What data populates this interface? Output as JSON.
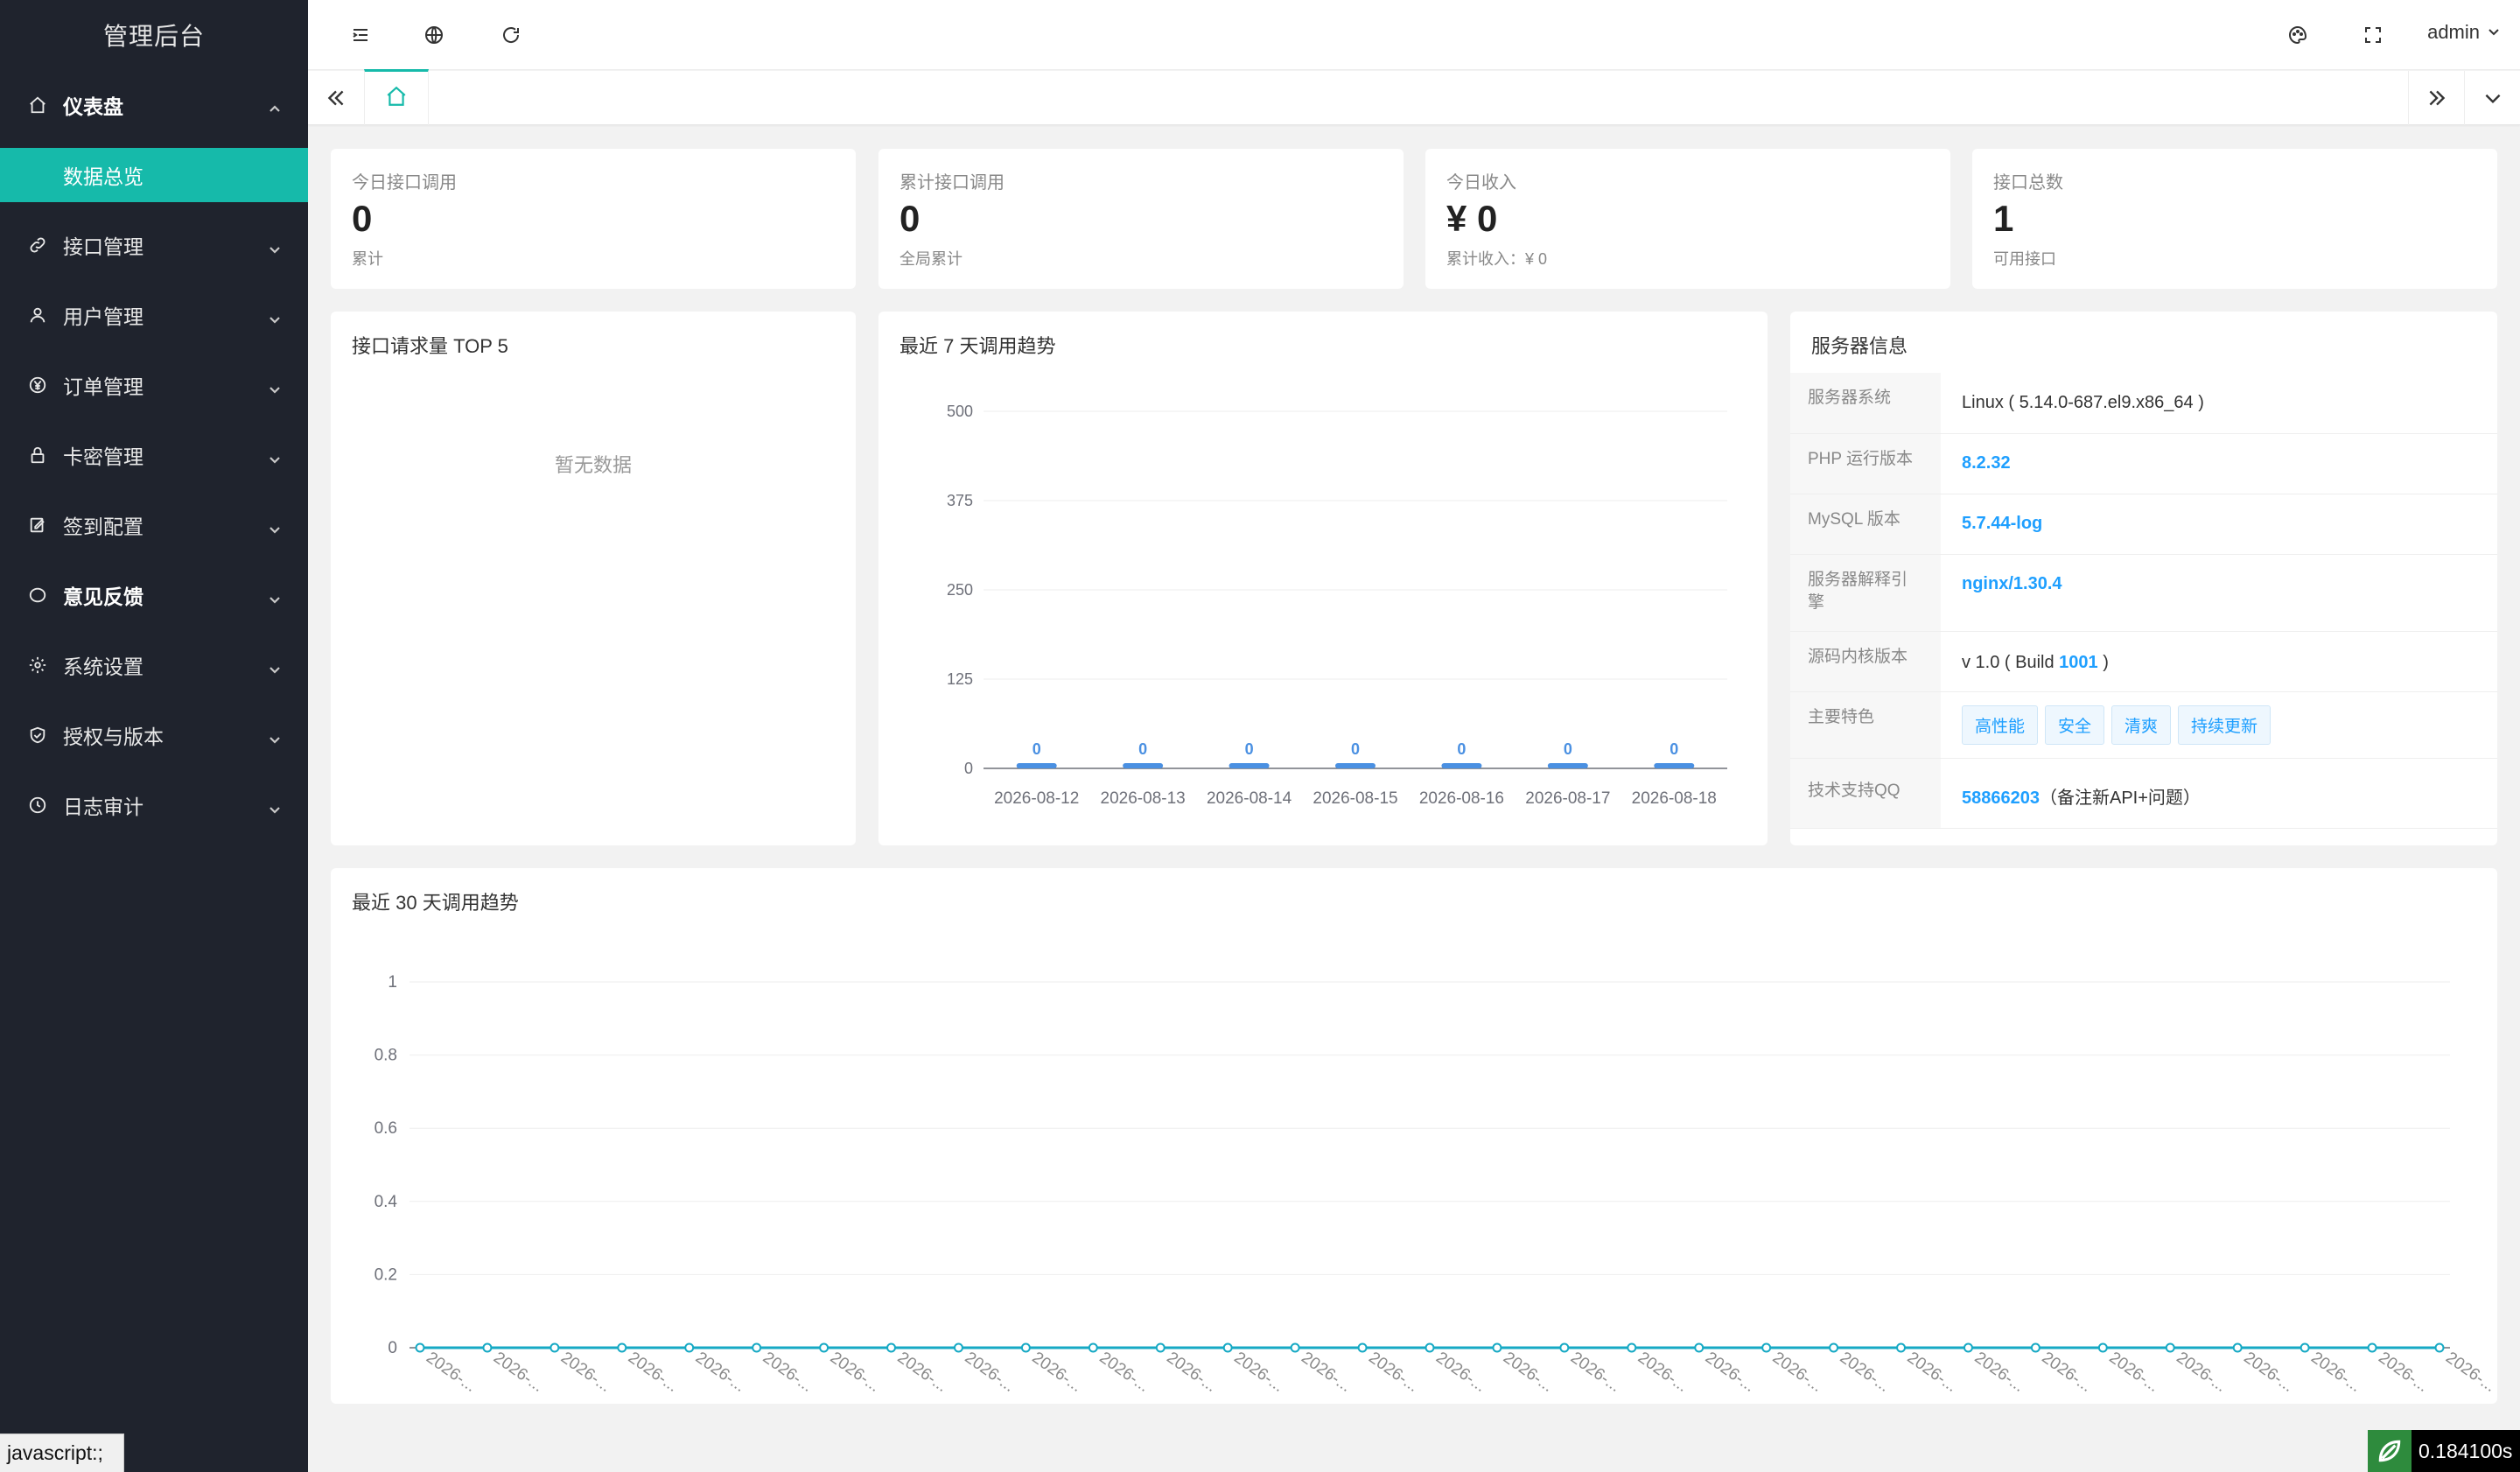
{
  "app": {
    "title": "管理后台"
  },
  "sidebar": {
    "items": [
      {
        "label": "仪表盘",
        "icon": "home-icon",
        "expanded": true,
        "children": [
          {
            "label": "数据总览",
            "active": true
          }
        ]
      },
      {
        "label": "接口管理",
        "icon": "link-icon"
      },
      {
        "label": "用户管理",
        "icon": "user-icon"
      },
      {
        "label": "订单管理",
        "icon": "yen-icon"
      },
      {
        "label": "卡密管理",
        "icon": "lock-icon"
      },
      {
        "label": "签到配置",
        "icon": "edit-icon"
      },
      {
        "label": "意见反馈",
        "icon": "chat-icon"
      },
      {
        "label": "系统设置",
        "icon": "gear-icon"
      },
      {
        "label": "授权与版本",
        "icon": "shield-icon"
      },
      {
        "label": "日志审计",
        "icon": "clock-icon"
      }
    ]
  },
  "topbar": {
    "user": "admin"
  },
  "status_bar": {
    "url": "javascript:;",
    "timer": "0.184100s"
  },
  "stats": [
    {
      "title": "今日接口调用",
      "value": "0",
      "sub": "累计"
    },
    {
      "title": "累计接口调用",
      "value": "0",
      "sub": "全局累计"
    },
    {
      "title": "今日收入",
      "value": "¥ 0",
      "sub": "累计收入：¥ 0"
    },
    {
      "title": "接口总数",
      "value": "1",
      "sub": "可用接口"
    }
  ],
  "top5": {
    "title": "接口请求量 TOP 5",
    "empty": "暂无数据"
  },
  "trend7": {
    "title": "最近 7 天调用趋势"
  },
  "trend30": {
    "title": "最近 30 天调用趋势"
  },
  "server": {
    "title": "服务器信息",
    "rows": [
      {
        "label": "服务器系统",
        "value": "Linux ( 5.14.0-687.el9.x86_64 )"
      },
      {
        "label": "PHP 运行版本",
        "value": "8.2.32"
      },
      {
        "label": "MySQL 版本",
        "value": "5.7.44-log"
      },
      {
        "label": "服务器解释引擎",
        "value": "nginx/1.30.4"
      },
      {
        "label": "源码内核版本",
        "value_prefix": "v 1.0 ( Build ",
        "value_build": "1001",
        "value_suffix": " )"
      },
      {
        "label": "主要特色",
        "tags": [
          "高性能",
          "安全",
          "清爽",
          "持续更新"
        ]
      },
      {
        "label": "技术支持QQ",
        "value_qq": "58866203",
        "value_note": "（备注新API+问题）"
      }
    ]
  },
  "chart_data": [
    {
      "type": "bar",
      "title": "最近 7 天调用趋势",
      "categories": [
        "2026-08-12",
        "2026-08-13",
        "2026-08-14",
        "2026-08-15",
        "2026-08-16",
        "2026-08-17",
        "2026-08-18"
      ],
      "values": [
        0,
        0,
        0,
        0,
        0,
        0,
        0
      ],
      "yticks": [
        "0",
        "125",
        "250",
        "375",
        "500"
      ],
      "ylim": [
        0,
        500
      ],
      "color": "#4a90e2"
    },
    {
      "type": "line",
      "title": "最近 30 天调用趋势",
      "categories": [
        "2026-...",
        "2026-...",
        "2026-...",
        "2026-...",
        "2026-...",
        "2026-...",
        "2026-...",
        "2026-...",
        "2026-...",
        "2026-...",
        "2026-...",
        "2026-...",
        "2026-...",
        "2026-...",
        "2026-...",
        "2026-...",
        "2026-...",
        "2026-...",
        "2026-...",
        "2026-...",
        "2026-...",
        "2026-...",
        "2026-...",
        "2026-...",
        "2026-...",
        "2026-...",
        "2026-...",
        "2026-...",
        "2026-...",
        "2026-...",
        "2026-..."
      ],
      "values": [
        0,
        0,
        0,
        0,
        0,
        0,
        0,
        0,
        0,
        0,
        0,
        0,
        0,
        0,
        0,
        0,
        0,
        0,
        0,
        0,
        0,
        0,
        0,
        0,
        0,
        0,
        0,
        0,
        0,
        0,
        0
      ],
      "yticks": [
        "0",
        "0.2",
        "0.4",
        "0.6",
        "0.8",
        "1"
      ],
      "ylim": [
        0,
        1
      ],
      "color": "#16a9c4"
    }
  ]
}
